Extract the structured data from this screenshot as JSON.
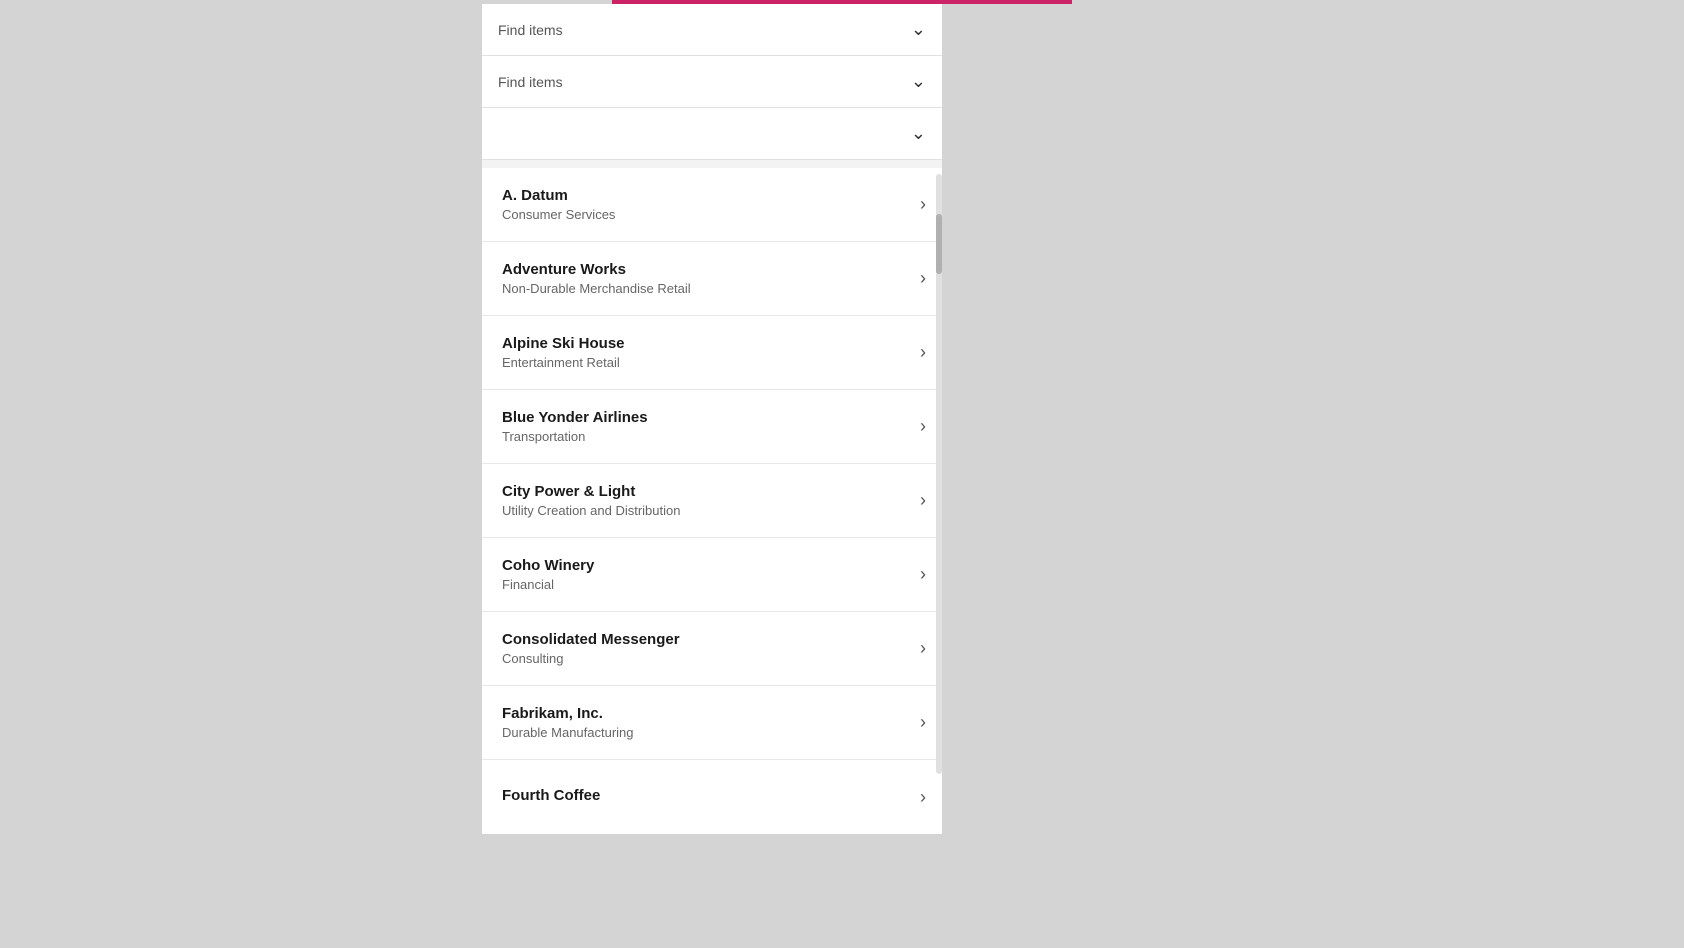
{
  "filters": [
    {
      "id": "filter1",
      "placeholder": "Find items",
      "hasText": true
    },
    {
      "id": "filter2",
      "placeholder": "Find items",
      "hasText": true
    },
    {
      "id": "filter3",
      "placeholder": "",
      "hasText": false
    }
  ],
  "list_items": [
    {
      "id": "a-datum",
      "title": "A. Datum",
      "subtitle": "Consumer Services"
    },
    {
      "id": "adventure-works",
      "title": "Adventure Works",
      "subtitle": "Non-Durable Merchandise Retail"
    },
    {
      "id": "alpine-ski-house",
      "title": "Alpine Ski House",
      "subtitle": "Entertainment Retail"
    },
    {
      "id": "blue-yonder-airlines",
      "title": "Blue Yonder Airlines",
      "subtitle": "Transportation"
    },
    {
      "id": "city-power-light",
      "title": "City Power & Light",
      "subtitle": "Utility Creation and Distribution"
    },
    {
      "id": "coho-winery",
      "title": "Coho Winery",
      "subtitle": "Financial"
    },
    {
      "id": "consolidated-messenger",
      "title": "Consolidated Messenger",
      "subtitle": "Consulting"
    },
    {
      "id": "fabrikam-inc",
      "title": "Fabrikam, Inc.",
      "subtitle": "Durable Manufacturing"
    },
    {
      "id": "fourth-coffee",
      "title": "Fourth Coffee",
      "subtitle": ""
    }
  ],
  "chevron_down": "⌄",
  "chevron_right": "›"
}
